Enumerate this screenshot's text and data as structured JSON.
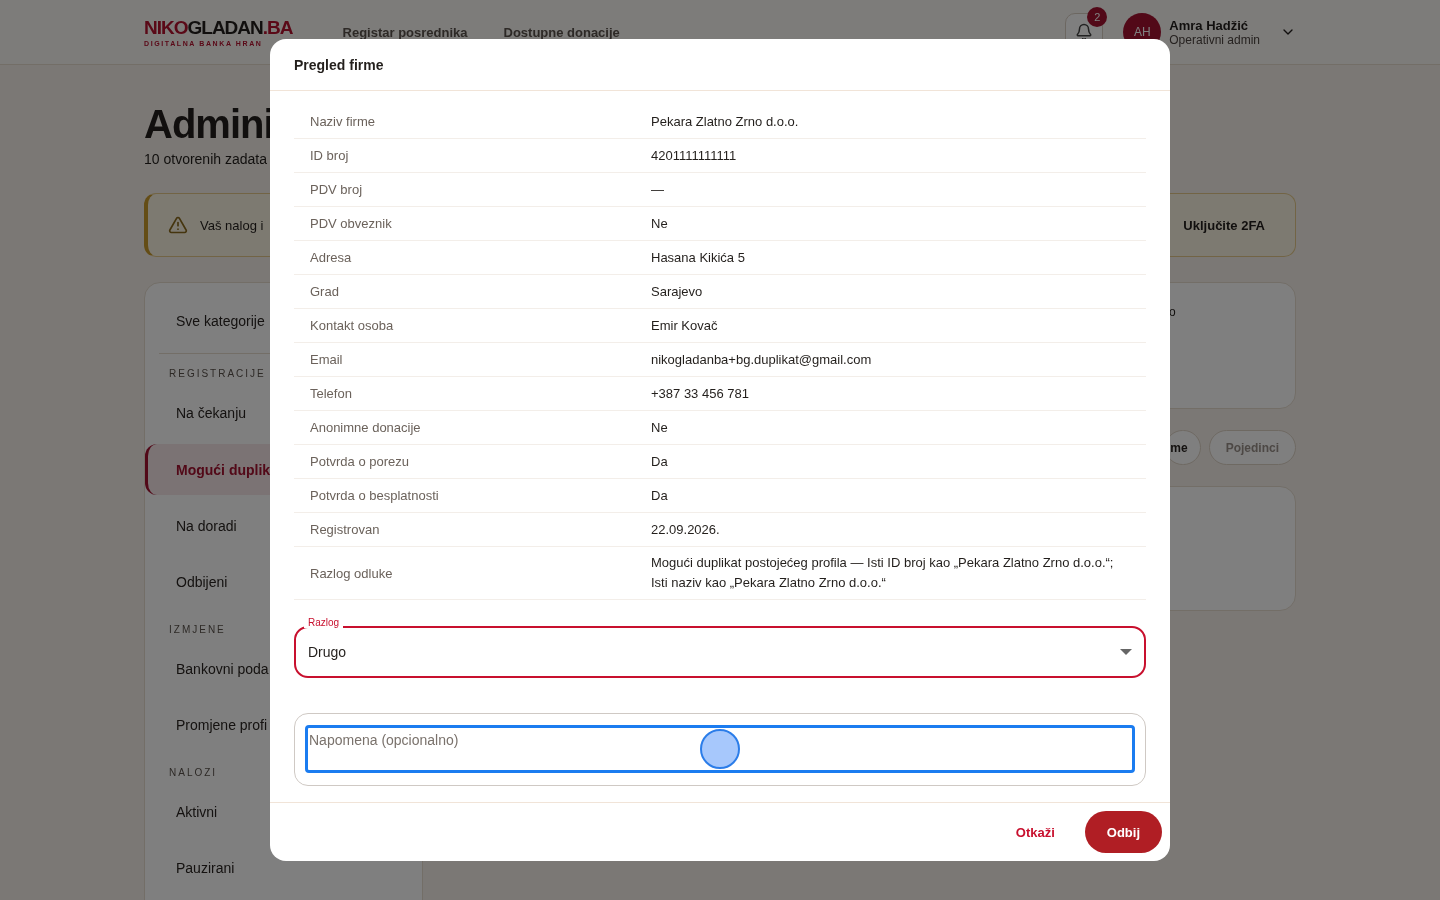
{
  "header": {
    "logo": {
      "accent_start": "NIKO",
      "main": "GLADAN",
      "accent_end": ".BA",
      "tagline": "DIGITALNA BANKA HRAN"
    },
    "nav": [
      {
        "label": "Registar posrednika"
      },
      {
        "label": "Dostupne donacije"
      }
    ],
    "notifications": {
      "count": "2"
    },
    "user": {
      "initials": "AH",
      "name": "Amra Hadžić",
      "role": "Operativni admin"
    }
  },
  "page": {
    "title": "Admini",
    "subtitle": "10 otvorenih zadata",
    "banner": {
      "text": "Vaš nalog i",
      "action": "Uključite 2FA"
    },
    "sidebar": [
      {
        "kind": "item",
        "label": "Sve kategorije",
        "selected": false
      },
      {
        "kind": "heading",
        "label": "REGISTRACIJE"
      },
      {
        "kind": "item",
        "label": "Na čekanju",
        "selected": false
      },
      {
        "kind": "item",
        "label": "Mogući duplik",
        "selected": true
      },
      {
        "kind": "item",
        "label": "Na doradi",
        "selected": false
      },
      {
        "kind": "item",
        "label": "Odbijeni",
        "selected": false
      },
      {
        "kind": "heading",
        "label": "IZMJENE"
      },
      {
        "kind": "item",
        "label": "Bankovni poda",
        "selected": false
      },
      {
        "kind": "item",
        "label": "Promjene profi",
        "selected": false
      },
      {
        "kind": "heading",
        "label": "NALOZI"
      },
      {
        "kind": "item",
        "label": "Aktivni",
        "selected": false
      },
      {
        "kind": "item",
        "label": "Pauzirani",
        "selected": false
      }
    ],
    "summary_card": {
      "text": "o"
    },
    "filters": [
      {
        "label": "me",
        "selected": true
      },
      {
        "label": "Pojedinci",
        "selected": false
      }
    ]
  },
  "dialog": {
    "title": "Pregled firme",
    "details": [
      {
        "label": "Naziv firme",
        "value": "Pekara Zlatno Zrno d.o.o."
      },
      {
        "label": "ID broj",
        "value": "4201111111111"
      },
      {
        "label": "PDV broj",
        "value": "—"
      },
      {
        "label": "PDV obveznik",
        "value": "Ne"
      },
      {
        "label": "Adresa",
        "value": "Hasana Kikića 5"
      },
      {
        "label": "Grad",
        "value": "Sarajevo"
      },
      {
        "label": "Kontakt osoba",
        "value": "Emir Kovač"
      },
      {
        "label": "Email",
        "value": "nikogladanba+bg.duplikat@gmail.com"
      },
      {
        "label": "Telefon",
        "value": "+387 33 456 781"
      },
      {
        "label": "Anonimne donacije",
        "value": "Ne"
      },
      {
        "label": "Potvrda o porezu",
        "value": "Da"
      },
      {
        "label": "Potvrda o besplatnosti",
        "value": "Da"
      },
      {
        "label": "Registrovan",
        "value": "22.09.2026."
      },
      {
        "label": "Razlog odluke",
        "value": "Mogući duplikat postojećeg profila — Isti ID broj kao „Pekara Zlatno Zrno d.o.o.“; Isti naziv kao „Pekara Zlatno Zrno d.o.o.“"
      }
    ],
    "reason": {
      "label": "Razlog",
      "value": "Drugo"
    },
    "note": {
      "placeholder": "Napomena (opcionalno)",
      "focused": true
    },
    "buttons": {
      "cancel": "Otkaži",
      "confirm": "Odbij"
    }
  }
}
